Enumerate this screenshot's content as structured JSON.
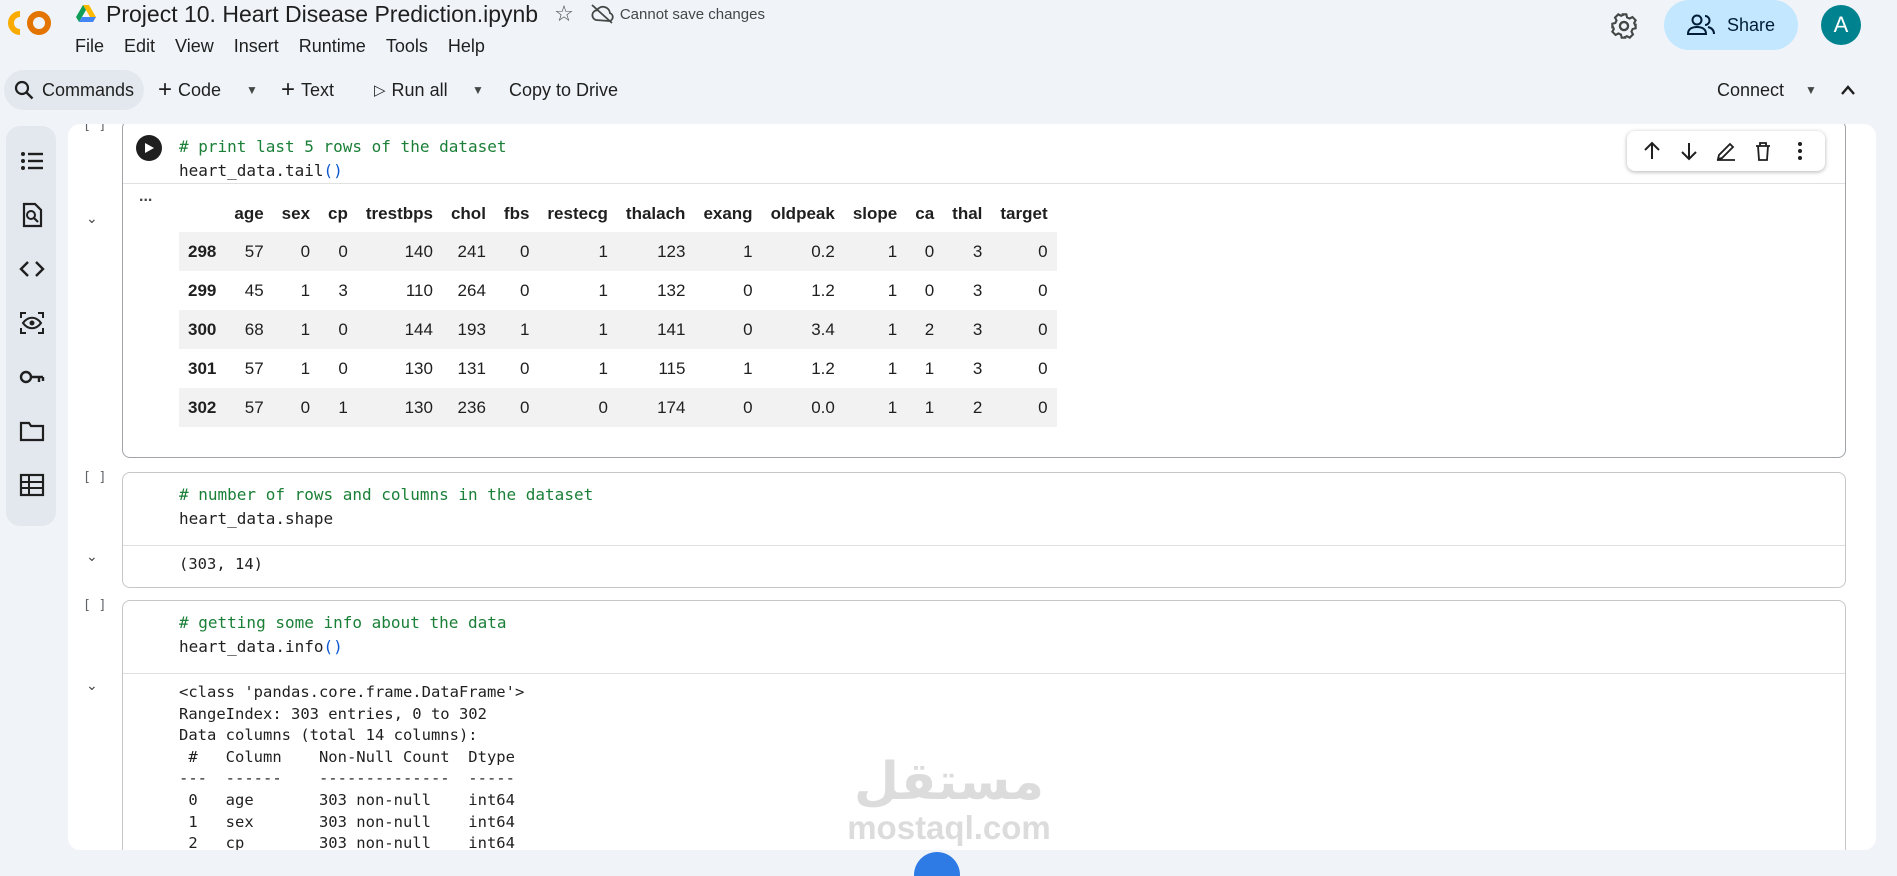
{
  "header": {
    "title": "Project 10. Heart Disease Prediction.ipynb",
    "save_status": "Cannot save changes",
    "share_label": "Share",
    "avatar_letter": "A",
    "menu": [
      "File",
      "Edit",
      "View",
      "Insert",
      "Runtime",
      "Tools",
      "Help"
    ]
  },
  "toolbar": {
    "commands_label": "Commands",
    "code_label": "Code",
    "text_label": "Text",
    "run_all_label": "Run all",
    "copy_label": "Copy to Drive",
    "connect_label": "Connect"
  },
  "cells": [
    {
      "bracket": "[ ]",
      "code_comment": "# print last 5 rows of the dataset",
      "code_line": "heart_data.tail",
      "paren": "()",
      "ellipsis": "...",
      "table": {
        "columns": [
          "",
          "age",
          "sex",
          "cp",
          "trestbps",
          "chol",
          "fbs",
          "restecg",
          "thalach",
          "exang",
          "oldpeak",
          "slope",
          "ca",
          "thal",
          "target"
        ],
        "rows": [
          [
            "298",
            "57",
            "0",
            "0",
            "140",
            "241",
            "0",
            "1",
            "123",
            "1",
            "0.2",
            "1",
            "0",
            "3",
            "0"
          ],
          [
            "299",
            "45",
            "1",
            "3",
            "110",
            "264",
            "0",
            "1",
            "132",
            "0",
            "1.2",
            "1",
            "0",
            "3",
            "0"
          ],
          [
            "300",
            "68",
            "1",
            "0",
            "144",
            "193",
            "1",
            "1",
            "141",
            "0",
            "3.4",
            "1",
            "2",
            "3",
            "0"
          ],
          [
            "301",
            "57",
            "1",
            "0",
            "130",
            "131",
            "0",
            "1",
            "115",
            "1",
            "1.2",
            "1",
            "1",
            "3",
            "0"
          ],
          [
            "302",
            "57",
            "0",
            "1",
            "130",
            "236",
            "0",
            "0",
            "174",
            "0",
            "0.0",
            "1",
            "1",
            "2",
            "0"
          ]
        ]
      }
    },
    {
      "bracket": "[ ]",
      "code_comment": "# number of rows and columns in the dataset",
      "code_line": "heart_data.shape",
      "output": "(303, 14)"
    },
    {
      "bracket": "[ ]",
      "code_comment": "# getting some info about the data",
      "code_line": "heart_data.info",
      "paren": "()",
      "output_lines": [
        "<class 'pandas.core.frame.DataFrame'>",
        "RangeIndex: 303 entries, 0 to 302",
        "Data columns (total 14 columns):",
        " #   Column    Non-Null Count  Dtype",
        "---  ------    --------------  -----",
        " 0   age       303 non-null    int64",
        " 1   sex       303 non-null    int64",
        " 2   cp        303 non-null    int64"
      ]
    }
  ],
  "watermark": {
    "arabic": "مستقل",
    "latin": "mostaql.com"
  },
  "colors": {
    "accent": "#c2e7ff",
    "comment": "#1a7f37",
    "paren": "#0b57d0",
    "avatar": "#00838f"
  }
}
